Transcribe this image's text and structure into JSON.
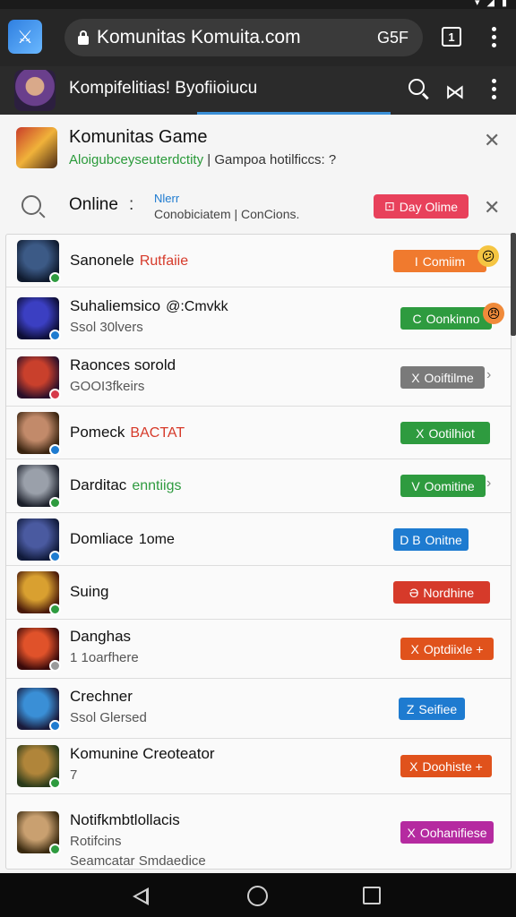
{
  "browser": {
    "url": "Komunitas Komuita.com",
    "url_extra": "G5F",
    "tab_count": "1"
  },
  "site": {
    "title": "Kompifelitias! Byofiioiucu"
  },
  "game_card": {
    "title": "Komunitas Game",
    "subtitle_green": "Aloigubceyseuterdctity",
    "subtitle_rest": " | Gampoa hotilficcs: ?"
  },
  "online_row": {
    "label": "Online",
    "colon": ":",
    "new_label": "Nlerr",
    "sub": "Conobiciatem | ConCions.",
    "button": "Day Olime"
  },
  "list_items": [
    {
      "title": "Sanonele",
      "accent": "Rutfaiie",
      "accent_color": "#d63a2a",
      "sub": "",
      "button": "Comiim",
      "button_prefix": "I",
      "button_color": "#f07a2e",
      "thumb": [
        "#3c5a86",
        "#0f1a2e"
      ],
      "badge": "#2e9b3f",
      "emoji": "😕"
    },
    {
      "title": "Suhaliemsico",
      "accent": "@:Cmvkk",
      "accent_color": "#111",
      "sub": "Ssol 30lvers",
      "button": "Oonkinno",
      "button_prefix": "C",
      "button_color": "#2e9b3f",
      "thumb": [
        "#3b3fc2",
        "#0d0e36"
      ],
      "badge": "#1e7bd0",
      "emoji": "😠"
    },
    {
      "title": "Raonces sorold",
      "accent": "",
      "accent_color": "#111",
      "sub": "GOOI3fkeirs",
      "button": "Ooiftilme",
      "button_prefix": "X",
      "button_color": "#7a7a7a",
      "thumb": [
        "#c9402c",
        "#2a0f2a"
      ],
      "badge": "#d63a4a",
      "emoji": ""
    },
    {
      "title": "Pomeck",
      "accent": "BACTAT",
      "accent_color": "#d63a2a",
      "sub": "",
      "button": "Ootilhiot",
      "button_prefix": "X",
      "button_color": "#2e9b3f",
      "thumb": [
        "#c28a6a",
        "#3a2410"
      ],
      "badge": "#1e7bd0",
      "emoji": ""
    },
    {
      "title": "Darditac",
      "accent": "enntiigs",
      "accent_color": "#2e9b3f",
      "sub": "",
      "button": "Oomitine",
      "button_prefix": "V",
      "button_color": "#2e9b3f",
      "thumb": [
        "#9aa0aa",
        "#1b1f2a"
      ],
      "badge": "#2e9b3f",
      "emoji": ""
    },
    {
      "title": "Domliace",
      "accent": "1ome",
      "accent_color": "#111",
      "sub": "",
      "button": "Onitne",
      "button_prefix": "D B",
      "button_color": "#1e7bd0",
      "thumb": [
        "#4a5aa0",
        "#101a3a"
      ],
      "badge": "#1e7bd0",
      "emoji": ""
    },
    {
      "title": "Suing",
      "accent": "",
      "accent_color": "#111",
      "sub": "",
      "button": "Nordhine",
      "button_prefix": "Ә",
      "button_color": "#d63a2a",
      "thumb": [
        "#d9a030",
        "#4a1a0a"
      ],
      "badge": "#2e9b3f",
      "emoji": ""
    },
    {
      "title": "Danghas",
      "accent": "",
      "accent_color": "#111",
      "sub": "1 1oarfhere",
      "button": "Optdiixle +",
      "button_prefix": "X",
      "button_color": "#e0521c",
      "thumb": [
        "#e0522a",
        "#3a0a0a"
      ],
      "badge": "#9a9a9a",
      "emoji": ""
    },
    {
      "title": "Crechner",
      "accent": "",
      "accent_color": "#111",
      "sub": "Ssol Glersed",
      "button": "Seifiee",
      "button_prefix": "Z",
      "button_color": "#1e7bd0",
      "thumb": [
        "#3a8fd6",
        "#1a1a3a"
      ],
      "badge": "#1e7bd0",
      "emoji": ""
    },
    {
      "title": "Komunine Creoteator",
      "accent": "",
      "accent_color": "#111",
      "sub": "7",
      "button": "Doohiste +",
      "button_prefix": "X",
      "button_color": "#e0521c",
      "thumb": [
        "#b0853a",
        "#2a3a1a"
      ],
      "badge": "#2e9b3f",
      "emoji": ""
    },
    {
      "title": "Notifkmbtlollacis",
      "accent": "",
      "accent_color": "#111",
      "sub": "Rotifcins",
      "sub2": "Seamcatar  Smdaedice",
      "button": "Oohanifiese",
      "button_prefix": "X",
      "button_color": "#b52aa0",
      "thumb": [
        "#c9a070",
        "#3a2a10"
      ],
      "badge": "#2e9b3f",
      "emoji": ""
    }
  ]
}
